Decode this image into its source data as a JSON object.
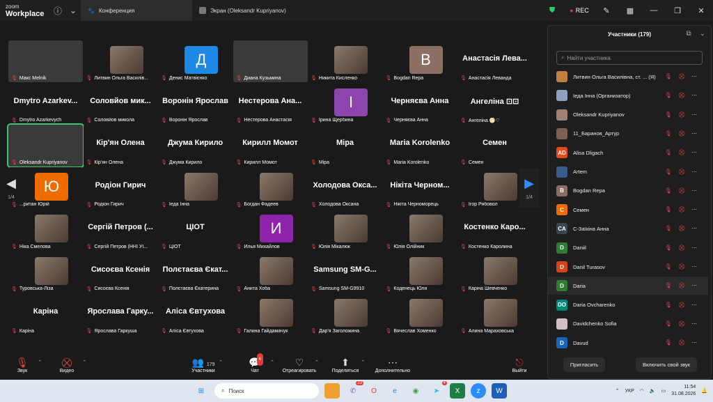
{
  "app": {
    "logo_top": "zoom",
    "logo_bottom": "Workplace"
  },
  "tabs": [
    {
      "label": "Конференция"
    },
    {
      "label": "Экран (Oleksandr Kupriyanov)"
    }
  ],
  "titlebar": {
    "rec_label": "REC"
  },
  "grid": {
    "page_left": "1/4",
    "page_right": "1/4"
  },
  "tiles": [
    {
      "type": "video",
      "name": "Макс Melnik"
    },
    {
      "type": "photo",
      "name": "Литвин Ольга Василів..."
    },
    {
      "type": "avatar",
      "letter": "Д",
      "color": "#1e88e5",
      "name": "Денис Матвієнко"
    },
    {
      "type": "video",
      "name": "Диана Кузьмина"
    },
    {
      "type": "photo",
      "name": "Никита Кисленко"
    },
    {
      "type": "avatar",
      "letter": "B",
      "color": "#8d6e63",
      "name": "Bogdan Repa"
    },
    {
      "type": "text",
      "big": "Анастасія Лева...",
      "name": "Анастасія Леванда"
    },
    {
      "type": "text",
      "big": "Dmytro Azarkev...",
      "name": "Dmytro Azarkevych"
    },
    {
      "type": "text",
      "big": "Соловйов мик...",
      "name": "Соловйов микола"
    },
    {
      "type": "text",
      "big": "Воронін Ярослав",
      "name": "Воронін Ярослав"
    },
    {
      "type": "text",
      "big": "Нестерова Ана...",
      "name": "Нестерова Анастасія"
    },
    {
      "type": "avatar",
      "letter": "І",
      "color": "#8e44ad",
      "name": "Ірина Щербина"
    },
    {
      "type": "text",
      "big": "Черняєва Анна",
      "name": "Черняєва Анна"
    },
    {
      "type": "text",
      "big": "Ангеліна ⊡⊡",
      "name": "Ангеліна 🌕♡"
    },
    {
      "type": "video",
      "name": "Oleksandr Kupriyanov",
      "speaking": true
    },
    {
      "type": "text",
      "big": "Кір'ян Олена",
      "name": "Кір'ян Олена"
    },
    {
      "type": "text",
      "big": "Джума Кирило",
      "name": "Джума Кирило"
    },
    {
      "type": "text",
      "big": "Кирилл Момот",
      "name": "Кирилл Момот"
    },
    {
      "type": "text",
      "big": "Міра",
      "name": "Міра"
    },
    {
      "type": "text",
      "big": "Maria Korolenko",
      "name": "Maria Korolenko"
    },
    {
      "type": "text",
      "big": "Семен",
      "name": "Семен"
    },
    {
      "type": "avatar",
      "letter": "Ю",
      "color": "#ef6c00",
      "name": "...ритан Юрій"
    },
    {
      "type": "text",
      "big": "Родіон Гирич",
      "name": "Родіон Гирич"
    },
    {
      "type": "photo",
      "name": "Іеда Інна"
    },
    {
      "type": "photo",
      "name": "Богдан Фадеев"
    },
    {
      "type": "text",
      "big": "Холодова Окса...",
      "name": "Холодова Оксана"
    },
    {
      "type": "text",
      "big": "Нікіта Черном...",
      "name": "Нікіта Черноморець"
    },
    {
      "type": "photo",
      "name": "Ігор Рябовол"
    },
    {
      "type": "photo",
      "name": "Ніка Смелова"
    },
    {
      "type": "text",
      "big": "Сергій Петров (...",
      "name": "Сергій Петров (ННІ УІ..."
    },
    {
      "type": "text",
      "big": "ЦІОТ",
      "name": "ЦІОТ"
    },
    {
      "type": "avatar",
      "letter": "И",
      "color": "#8e24aa",
      "name": "Илья Михайлов"
    },
    {
      "type": "photo",
      "name": "Юлія Мікалюк"
    },
    {
      "type": "photo",
      "name": "Юлія Олійник"
    },
    {
      "type": "text",
      "big": "Костенко Каро...",
      "name": "Костенко Каролина"
    },
    {
      "type": "photo",
      "name": "Туровська-Ліза"
    },
    {
      "type": "text",
      "big": "Сисоєва Ксенія",
      "name": "Сисоєва Ксенія"
    },
    {
      "type": "text",
      "big": "Полєтаєва Єкат...",
      "name": "Полєтаєва Єкатерина"
    },
    {
      "type": "photo",
      "name": "Анита Хоба"
    },
    {
      "type": "text",
      "big": "Samsung SM-G...",
      "name": "Samsung SM-G9910"
    },
    {
      "type": "photo",
      "name": "Коденець Юля"
    },
    {
      "type": "photo",
      "name": "Каріна Шевченко"
    },
    {
      "type": "text",
      "big": "Каріна",
      "name": "Каріна"
    },
    {
      "type": "text",
      "big": "Ярослава Гарку...",
      "name": "Ярослава Гаркуша"
    },
    {
      "type": "text",
      "big": "Аліса Євтухова",
      "name": "Аліса Євтухова"
    },
    {
      "type": "photo",
      "name": "Галина Гайдамачук"
    },
    {
      "type": "photo",
      "name": "Дар'я Заголожина"
    },
    {
      "type": "photo",
      "name": "Вячеслав Хоменко"
    },
    {
      "type": "photo",
      "name": "Алина Мараховська"
    }
  ],
  "toolbar": {
    "audio": "Звук",
    "video": "Видео",
    "participants": "Участники",
    "participants_count": "179",
    "chat": "Чат",
    "chat_badge": "6",
    "react": "Отреагировать",
    "share": "Поделиться",
    "more": "Дополнительно",
    "leave": "Выйти"
  },
  "panel": {
    "title": "Участники (179)",
    "search_placeholder": "Найти участника",
    "invite": "Пригласить",
    "unmute_me": "Включить свой звук",
    "participants": [
      {
        "name": "Литвин Ольга Василівна, ст. ... (Я)",
        "avatar": "photo",
        "color": "#c08040"
      },
      {
        "name": "Іеда Інна (Организатор)",
        "avatar": "photo",
        "color": "#8aa0c0"
      },
      {
        "name": "Oleksandr Kupriyanov",
        "avatar": "photo",
        "color": "#a08070"
      },
      {
        "name": "11_Баранов_Артур",
        "avatar": "photo",
        "color": "#806050"
      },
      {
        "name": "Alisa Dligach",
        "avatar": "AD",
        "color": "#e64a19"
      },
      {
        "name": "Artem",
        "avatar": "photo",
        "color": "#3a5a8a"
      },
      {
        "name": "Bogdan Repa",
        "avatar": "B",
        "color": "#8d6e63"
      },
      {
        "name": "Семен",
        "avatar": "C",
        "color": "#ef6c00"
      },
      {
        "name": "C-Заїкіна Анна",
        "avatar": "CA",
        "color": "#37474f"
      },
      {
        "name": "Daniil",
        "avatar": "D",
        "color": "#2e7d32"
      },
      {
        "name": "Danil Turasov",
        "avatar": "D",
        "color": "#d84315"
      },
      {
        "name": "Daria",
        "avatar": "D",
        "color": "#2e7d32"
      },
      {
        "name": "Daria Ovcharenko",
        "avatar": "DO",
        "color": "#00897b"
      },
      {
        "name": "Davidchenko Sofia",
        "avatar": "photo",
        "color": "#d0c0c0"
      },
      {
        "name": "Davud",
        "avatar": "D",
        "color": "#1565c0"
      }
    ]
  },
  "taskbar": {
    "search": "Поиск",
    "lang": "УКР",
    "time": "11:54",
    "date": "31.08.2026",
    "badge_mail": "23",
    "badge_tg": "4"
  }
}
